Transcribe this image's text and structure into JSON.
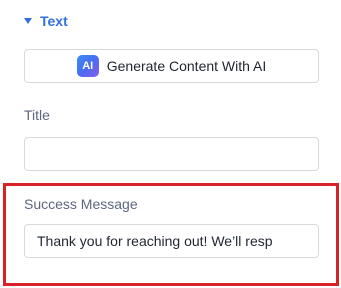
{
  "section": {
    "title": "Text",
    "caret_icon": "caret-down-icon"
  },
  "ai_button": {
    "badge_text": "AI",
    "label": "Generate Content With AI"
  },
  "fields": {
    "title": {
      "label": "Title",
      "value": ""
    },
    "success_message": {
      "label": "Success Message",
      "value": "Thank you for reaching out! We’ll resp"
    }
  },
  "colors": {
    "accent": "#2f6fe0",
    "highlight": "#d92128",
    "label": "#5d6680"
  }
}
